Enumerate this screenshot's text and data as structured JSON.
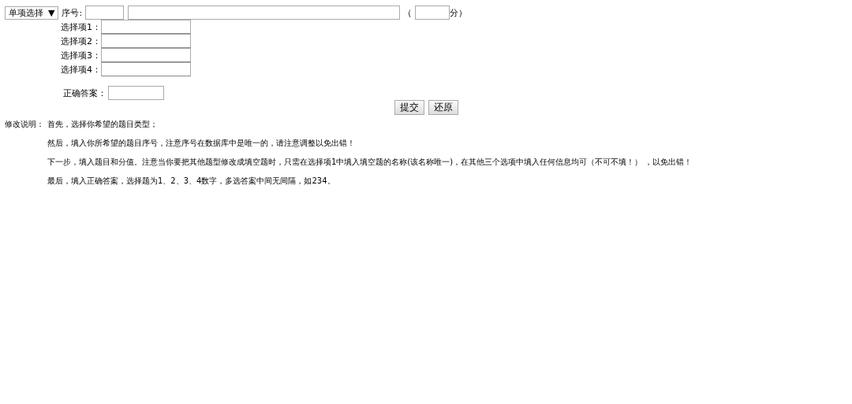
{
  "question_type": {
    "value": "单项选择",
    "arrow": "▼"
  },
  "number_label": "序号:",
  "score": {
    "open": "（",
    "unit": "分）"
  },
  "options": [
    {
      "label": "选择项1："
    },
    {
      "label": "选择项2："
    },
    {
      "label": "选择项3："
    },
    {
      "label": "选择项4："
    }
  ],
  "answer_label": "正确答案：",
  "buttons": [
    "提交",
    "还原"
  ],
  "notes": {
    "heading": "修改说明：",
    "lines": [
      "首先，选择你希望的题目类型；",
      "然后，填入你所希望的题目序号，注意序号在数据库中是唯一的，请注意调整以免出错！",
      "下一步，填入题目和分值。注意当你要把其他题型修改成填空题时，只需在选择项1中填入填空题的名称(该名称唯一)，在其他三个选项中填入任何信息均可（不可不填！） ，以免出错！",
      "最后，填入正确答案，选择题为1、2、3、4数字，多选答案中间无间隔，如234。"
    ]
  }
}
